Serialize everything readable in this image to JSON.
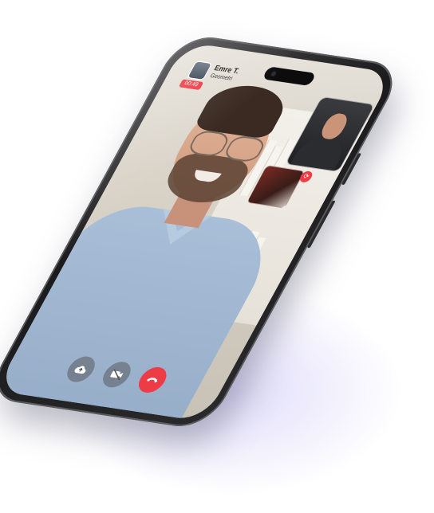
{
  "call": {
    "caller_name": "Emre T.",
    "caller_subject": "Geometri",
    "timer": "00:49"
  },
  "icons": {
    "upload": "cloud-upload-icon",
    "camera_off": "video-off-icon",
    "end_call": "phone-hangup-icon",
    "switch_camera": "camera-switch-icon"
  },
  "colors": {
    "accent_red": "#ee3c47",
    "shirt_blue": "#a9bfd8",
    "phone_frame": "#1b1b1d",
    "glow": "#968cebe"
  }
}
